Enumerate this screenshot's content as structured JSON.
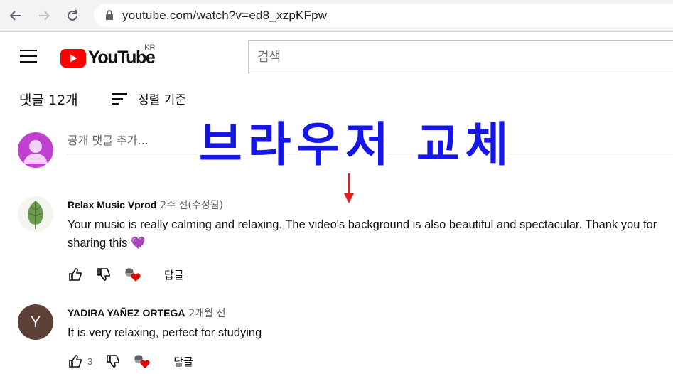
{
  "browser": {
    "url": "youtube.com/watch?v=ed8_xzpKFpw"
  },
  "header": {
    "logo_text": "YouTube",
    "region": "KR",
    "search_placeholder": "검색"
  },
  "comments_header": {
    "count_label": "댓글 12개",
    "sort_label": "정렬 기준"
  },
  "add_comment": {
    "placeholder": "공개 댓글 추가..."
  },
  "overlay": {
    "text": "브라우저 교체"
  },
  "colors": {
    "overlay": "#1616e8",
    "arrow": "#e02020",
    "heart": "#e00000",
    "user_avatar": "#c040d0",
    "yadira_avatar": "#5d4037"
  },
  "comments": [
    {
      "author": "Relax Music Vprod",
      "time": "2주 전(수정됨)",
      "text": "Your music is really calming and relaxing. The video's background is also beautiful and spectacular. Thank you for sharing this 💜",
      "likes": "",
      "reply_label": "답글",
      "avatar_icon": "leaf-icon"
    },
    {
      "author": "YADIRA YAÑEZ ORTEGA",
      "time": "2개월 전",
      "text": "It is very relaxing, perfect for studying",
      "likes": "3",
      "reply_label": "답글",
      "avatar_letter": "Y"
    }
  ]
}
